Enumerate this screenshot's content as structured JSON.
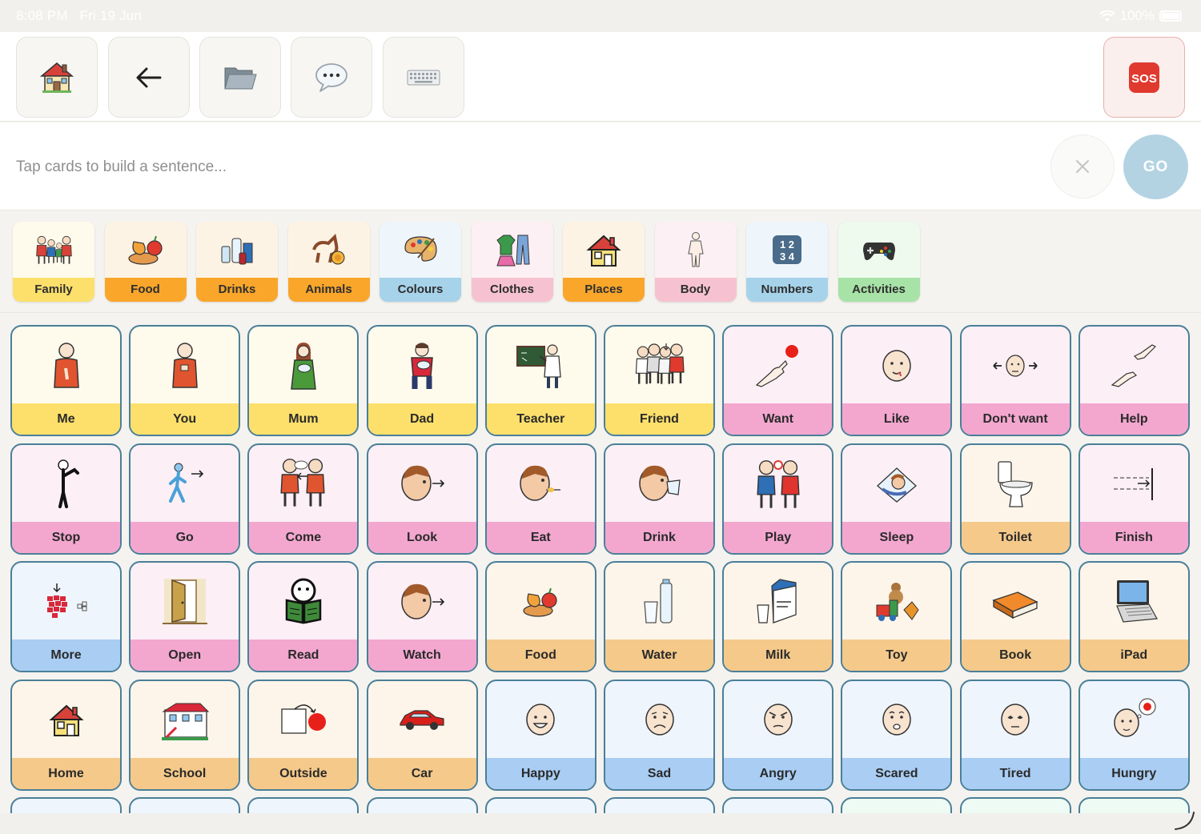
{
  "status_bar": {
    "time": "8:08 PM",
    "date": "Fri 19 Jun",
    "battery": "100%"
  },
  "colors": {
    "accent_go": "#b3d3e3",
    "card_border": "#4b7f98",
    "sos_red": "#e03a2f",
    "themes": {
      "yellow": {
        "bg": "#fefaec",
        "label": "#fde06b"
      },
      "pink": {
        "bg": "#fceff6",
        "label": "#f3a7cf"
      },
      "peach": {
        "bg": "#fdf5ea",
        "label": "#f5c98a"
      },
      "blue": {
        "bg": "#eef5fc",
        "label": "#a9cdf3"
      }
    }
  },
  "toolbar": {
    "buttons": [
      {
        "name": "home-button",
        "icon": "house-icon"
      },
      {
        "name": "back-button",
        "icon": "arrow-left-icon"
      },
      {
        "name": "folder-button",
        "icon": "folder-icon"
      },
      {
        "name": "speech-button",
        "icon": "speech-bubble-icon"
      },
      {
        "name": "keyboard-button",
        "icon": "keyboard-icon"
      }
    ],
    "sos_label": "SOS"
  },
  "sentence": {
    "placeholder": "Tap cards to build a sentence...",
    "go_label": "GO"
  },
  "categories": [
    {
      "label": "Family",
      "bg": "#fefaec",
      "label_bg": "#fde06b",
      "icon": "family-icon"
    },
    {
      "label": "Food",
      "bg": "#fdf3e4",
      "label_bg": "#f9a62b",
      "icon": "food-icon"
    },
    {
      "label": "Drinks",
      "bg": "#fdf3e4",
      "label_bg": "#f9a62b",
      "icon": "drinks-icon"
    },
    {
      "label": "Animals",
      "bg": "#fdf3e4",
      "label_bg": "#f9a62b",
      "icon": "animals-icon"
    },
    {
      "label": "Colours",
      "bg": "#eef6fb",
      "label_bg": "#a6d3ea",
      "icon": "palette-icon"
    },
    {
      "label": "Clothes",
      "bg": "#fdf0f4",
      "label_bg": "#f6c2d1",
      "icon": "clothes-icon"
    },
    {
      "label": "Places",
      "bg": "#fdf3e4",
      "label_bg": "#f9a62b",
      "icon": "house-icon"
    },
    {
      "label": "Body",
      "bg": "#fdf0f4",
      "label_bg": "#f6c2d1",
      "icon": "body-icon"
    },
    {
      "label": "Numbers",
      "bg": "#eef6fb",
      "label_bg": "#a6d3ea",
      "icon": "numbers-icon"
    },
    {
      "label": "Activities",
      "bg": "#eefaee",
      "label_bg": "#a7e2a6",
      "icon": "gamepad-icon"
    }
  ],
  "cards": [
    [
      {
        "label": "Me",
        "theme": "yellow",
        "icon": "me-icon"
      },
      {
        "label": "You",
        "theme": "yellow",
        "icon": "you-icon"
      },
      {
        "label": "Mum",
        "theme": "yellow",
        "icon": "mum-icon"
      },
      {
        "label": "Dad",
        "theme": "yellow",
        "icon": "dad-icon"
      },
      {
        "label": "Teacher",
        "theme": "yellow",
        "icon": "teacher-icon"
      },
      {
        "label": "Friend",
        "theme": "yellow",
        "icon": "friend-icon"
      },
      {
        "label": "Want",
        "theme": "pink",
        "icon": "want-icon"
      },
      {
        "label": "Like",
        "theme": "pink",
        "icon": "like-icon"
      },
      {
        "label": "Don't want",
        "theme": "pink",
        "icon": "dont-want-icon"
      },
      {
        "label": "Help",
        "theme": "pink",
        "icon": "help-icon"
      }
    ],
    [
      {
        "label": "Stop",
        "theme": "pink",
        "icon": "stop-icon"
      },
      {
        "label": "Go",
        "theme": "pink",
        "icon": "go-icon"
      },
      {
        "label": "Come",
        "theme": "pink",
        "icon": "come-icon"
      },
      {
        "label": "Look",
        "theme": "pink",
        "icon": "look-icon"
      },
      {
        "label": "Eat",
        "theme": "pink",
        "icon": "eat-icon"
      },
      {
        "label": "Drink",
        "theme": "pink",
        "icon": "drink-icon"
      },
      {
        "label": "Play",
        "theme": "pink",
        "icon": "play-icon"
      },
      {
        "label": "Sleep",
        "theme": "pink",
        "icon": "sleep-icon"
      },
      {
        "label": "Toilet",
        "theme": "peach",
        "icon": "toilet-icon"
      },
      {
        "label": "Finish",
        "theme": "pink",
        "icon": "finish-icon"
      }
    ],
    [
      {
        "label": "More",
        "theme": "blue",
        "icon": "more-icon"
      },
      {
        "label": "Open",
        "theme": "pink",
        "icon": "open-door-icon"
      },
      {
        "label": "Read",
        "theme": "pink",
        "icon": "read-icon"
      },
      {
        "label": "Watch",
        "theme": "pink",
        "icon": "watch-icon"
      },
      {
        "label": "Food",
        "theme": "peach",
        "icon": "food-icon"
      },
      {
        "label": "Water",
        "theme": "peach",
        "icon": "water-icon"
      },
      {
        "label": "Milk",
        "theme": "peach",
        "icon": "milk-icon"
      },
      {
        "label": "Toy",
        "theme": "peach",
        "icon": "toy-icon"
      },
      {
        "label": "Book",
        "theme": "peach",
        "icon": "book-icon"
      },
      {
        "label": "iPad",
        "theme": "peach",
        "icon": "laptop-icon"
      }
    ],
    [
      {
        "label": "Home",
        "theme": "peach",
        "icon": "house-icon"
      },
      {
        "label": "School",
        "theme": "peach",
        "icon": "school-icon"
      },
      {
        "label": "Outside",
        "theme": "peach",
        "icon": "outside-icon"
      },
      {
        "label": "Car",
        "theme": "peach",
        "icon": "car-icon"
      },
      {
        "label": "Happy",
        "theme": "blue",
        "icon": "happy-face-icon"
      },
      {
        "label": "Sad",
        "theme": "blue",
        "icon": "sad-face-icon"
      },
      {
        "label": "Angry",
        "theme": "blue",
        "icon": "angry-face-icon"
      },
      {
        "label": "Scared",
        "theme": "blue",
        "icon": "scared-face-icon"
      },
      {
        "label": "Tired",
        "theme": "blue",
        "icon": "tired-face-icon"
      },
      {
        "label": "Hungry",
        "theme": "blue",
        "icon": "hungry-face-icon"
      }
    ]
  ]
}
